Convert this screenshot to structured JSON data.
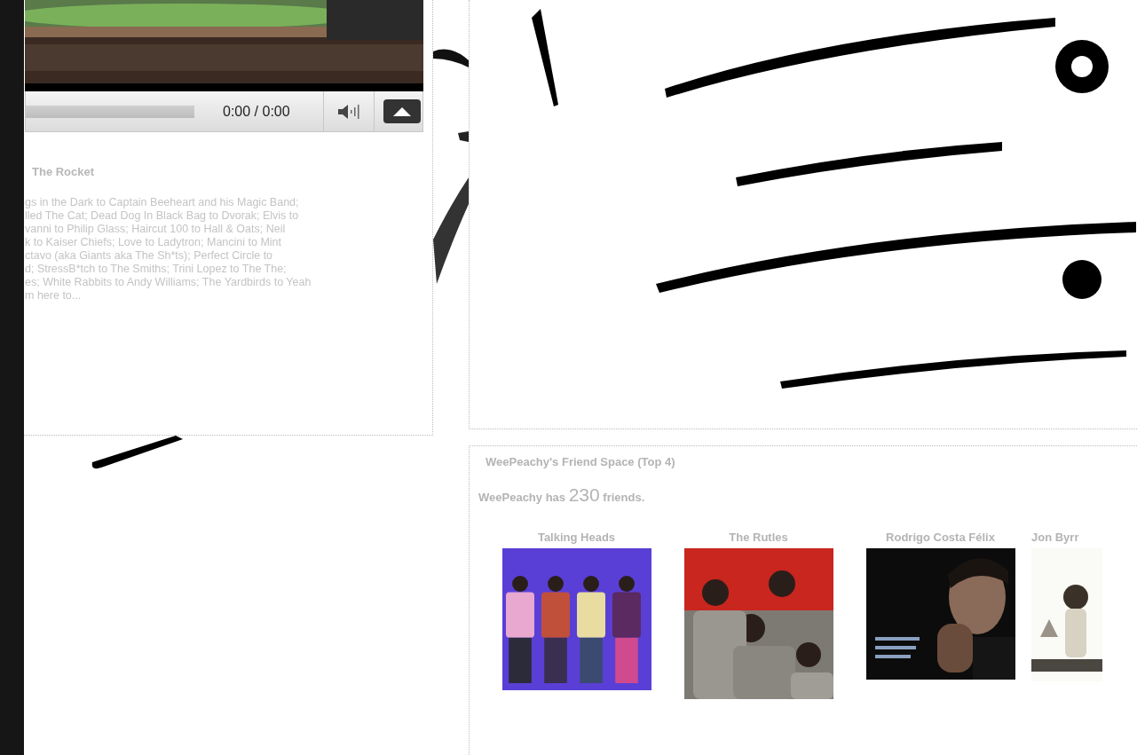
{
  "video": {
    "kind": "picture",
    "time": "0:00 / 0:00"
  },
  "about": {
    "title": "The Rocket",
    "lines": [
      "gs in the Dark to Captain Beeheart and his Magic Band;",
      "lled The Cat; Dead Dog In Black Bag to Dvorak; Elvis to",
      "vanni to Philip Glass; Haircut 100 to Hall & Oats; Neil",
      "k to Kaiser Chiefs; Love to Ladytron; Mancini to Mint",
      "ctavo (aka Giants aka The Sh*ts); Perfect Circle to",
      "d; StressB*tch to The Smiths; Trini Lopez to The The;",
      "es; White Rabbits to Andy Williams; The Yardbirds to Yeah",
      "m here to..."
    ]
  },
  "friend_space": {
    "title": "WeePeachy's Friend Space (Top 4)",
    "count_prefix": "WeePeachy has",
    "count": "230",
    "count_suffix": "friends.",
    "friends": [
      {
        "name": "Talking Heads",
        "kind": "picture"
      },
      {
        "name": "The Rutles",
        "kind": "picture"
      },
      {
        "name": "Rodrigo Costa Félix",
        "kind": "picture"
      },
      {
        "name": "Jon Byrr",
        "kind": "picture"
      }
    ]
  }
}
